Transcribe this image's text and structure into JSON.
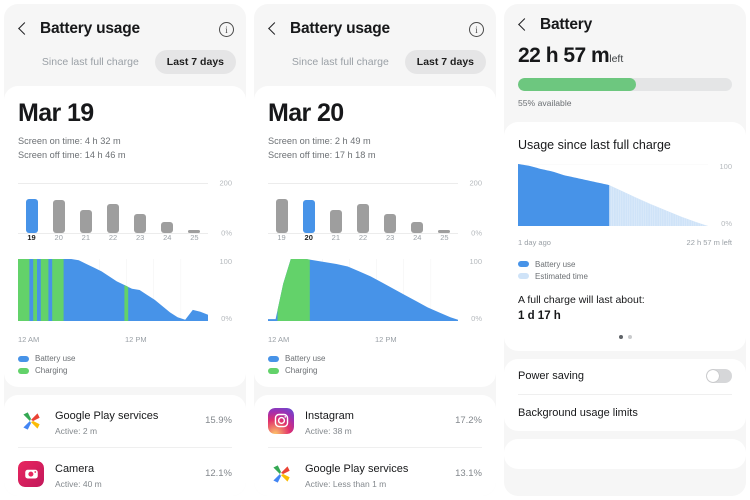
{
  "colors": {
    "battery_use": "#4793e8",
    "charging": "#63d26a",
    "estimated": "#cfe3f8",
    "bar_default": "#9e9e9e",
    "bar_selected": "#4793e8",
    "battery_fill": "#6dc77f",
    "panel_bg": "#f6f6f6",
    "card_bg": "#ffffff"
  },
  "screen1": {
    "appbar": {
      "title": "Battery usage",
      "back_icon": "chevron-left-icon",
      "info_icon": "info-circle-icon"
    },
    "segmented": {
      "option1": "Since last full charge",
      "option2": "Last 7 days",
      "selected": "Last 7 days"
    },
    "date": "Mar 19",
    "screen_on": "Screen on time: 4 h 32 m",
    "screen_off": "Screen off time: 14 h 46 m",
    "legend": {
      "battery_use": "Battery use",
      "charging": "Charging"
    },
    "axis": {
      "left_time": "12 AM",
      "mid_time": "12 PM",
      "top": "100",
      "bottom": "0%"
    },
    "apps": [
      {
        "name": "Google Play services",
        "sub": "Active: 2 m",
        "pct": "15.9%",
        "icon": "google-play-services-icon"
      },
      {
        "name": "Camera",
        "sub": "Active: 40 m",
        "pct": "12.1%",
        "icon": "camera-app-icon"
      }
    ]
  },
  "screen2": {
    "appbar": {
      "title": "Battery usage",
      "back_icon": "chevron-left-icon",
      "info_icon": "info-circle-icon"
    },
    "segmented": {
      "option1": "Since last full charge",
      "option2": "Last 7 days",
      "selected": "Last 7 days"
    },
    "date": "Mar 20",
    "screen_on": "Screen on time: 2 h 49 m",
    "screen_off": "Screen off time: 17 h 18 m",
    "legend": {
      "battery_use": "Battery use",
      "charging": "Charging"
    },
    "axis": {
      "left_time": "12 AM",
      "mid_time": "12 PM",
      "top": "100",
      "bottom": "0%"
    },
    "apps": [
      {
        "name": "Instagram",
        "sub": "Active: 38 m",
        "pct": "17.2%",
        "icon": "instagram-icon"
      },
      {
        "name": "Google Play services",
        "sub": "Active: Less than 1 m",
        "pct": "13.1%",
        "icon": "google-play-services-icon"
      }
    ]
  },
  "screen3": {
    "appbar": {
      "title": "Battery",
      "back_icon": "chevron-left-icon"
    },
    "time_left": "22 h 57 m",
    "time_left_suffix": "left",
    "percent_available": "55% available",
    "battery_percent": 55,
    "usage_title": "Usage since last full charge",
    "axis": {
      "left": "1 day ago",
      "right": "22 h 57 m left",
      "top": "100",
      "bottom": "0%"
    },
    "legend": {
      "battery_use": "Battery use",
      "estimated": "Estimated time"
    },
    "full_charge_label": "A full charge will last about:",
    "full_charge_value": "1 d 17 h",
    "settings": [
      {
        "label": "Power saving",
        "control": "toggle",
        "on": false
      },
      {
        "label": "Background usage limits",
        "control": "none"
      }
    ]
  },
  "chart_data": [
    {
      "id": "screen1-bars",
      "type": "bar",
      "title": "Daily battery usage Mar 19-25",
      "categories": [
        "19",
        "20",
        "21",
        "22",
        "23",
        "24",
        "25"
      ],
      "values": [
        100,
        98,
        66,
        84,
        56,
        32,
        9
      ],
      "selected_index": 0,
      "ylim": [
        0,
        200
      ],
      "ytick_labels": [
        "200",
        "0%"
      ],
      "xlabel": "",
      "ylabel": ""
    },
    {
      "id": "screen1-area",
      "type": "area",
      "title": "Battery level over day Mar 19",
      "xlabel": "",
      "ylabel": "",
      "ylim": [
        0,
        100
      ],
      "xtick_labels": [
        "12 AM",
        "12 PM"
      ],
      "ytick_labels": [
        "100",
        "0%"
      ],
      "series": [
        {
          "name": "Battery use",
          "color": "#4793e8"
        },
        {
          "name": "Charging",
          "color": "#63d26a"
        }
      ],
      "x": [
        0,
        4,
        8,
        12,
        16,
        20,
        24,
        28,
        32,
        36,
        40,
        44,
        48,
        52,
        56,
        60,
        64,
        68,
        72,
        76,
        80,
        84,
        88,
        92,
        96,
        100
      ],
      "values": [
        100,
        100,
        100,
        100,
        100,
        100,
        100,
        100,
        98,
        92,
        86,
        80,
        72,
        64,
        58,
        52,
        50,
        42,
        34,
        24,
        14,
        6,
        2,
        18,
        15,
        10
      ],
      "charging_spans": [
        [
          0,
          6
        ],
        [
          8,
          10
        ],
        [
          12,
          16
        ],
        [
          18,
          24
        ],
        [
          56,
          58
        ]
      ]
    },
    {
      "id": "screen2-bars",
      "type": "bar",
      "title": "Daily battery usage Mar 19-25",
      "categories": [
        "19",
        "20",
        "21",
        "22",
        "23",
        "24",
        "25"
      ],
      "values": [
        100,
        98,
        66,
        84,
        56,
        32,
        9
      ],
      "selected_index": 1,
      "ylim": [
        0,
        200
      ],
      "ytick_labels": [
        "200",
        "0%"
      ],
      "xlabel": "",
      "ylabel": ""
    },
    {
      "id": "screen2-area",
      "type": "area",
      "title": "Battery level over day Mar 20",
      "xlabel": "",
      "ylabel": "",
      "ylim": [
        0,
        100
      ],
      "xtick_labels": [
        "12 AM",
        "12 PM"
      ],
      "ytick_labels": [
        "100",
        "0%"
      ],
      "series": [
        {
          "name": "Battery use",
          "color": "#4793e8"
        },
        {
          "name": "Charging",
          "color": "#63d26a"
        }
      ],
      "x": [
        0,
        4,
        8,
        12,
        16,
        20,
        24,
        30,
        36,
        42,
        48,
        54,
        60,
        66,
        72,
        78,
        84,
        90,
        96,
        100
      ],
      "values": [
        3,
        3,
        60,
        100,
        100,
        100,
        98,
        95,
        92,
        88,
        80,
        72,
        62,
        52,
        42,
        32,
        22,
        14,
        6,
        2
      ],
      "charging_spans": [
        [
          5,
          22
        ]
      ]
    },
    {
      "id": "screen3-area",
      "type": "area",
      "title": "Usage since last full charge",
      "xlabel": "",
      "ylabel": "",
      "ylim": [
        0,
        100
      ],
      "xtick_labels": [
        "1 day ago",
        "22 h 57 m left"
      ],
      "ytick_labels": [
        "100",
        "0%"
      ],
      "series": [
        {
          "name": "Battery use",
          "color": "#4793e8"
        },
        {
          "name": "Estimated time",
          "color": "#cfe3f8"
        }
      ],
      "x": [
        0,
        6,
        12,
        18,
        24,
        30,
        36,
        42,
        48,
        55,
        62,
        70,
        78,
        86,
        94,
        100
      ],
      "values": [
        100,
        97,
        92,
        88,
        82,
        78,
        74,
        70,
        66,
        56,
        46,
        35,
        25,
        15,
        6,
        0
      ],
      "actual_end_x": 48
    }
  ]
}
